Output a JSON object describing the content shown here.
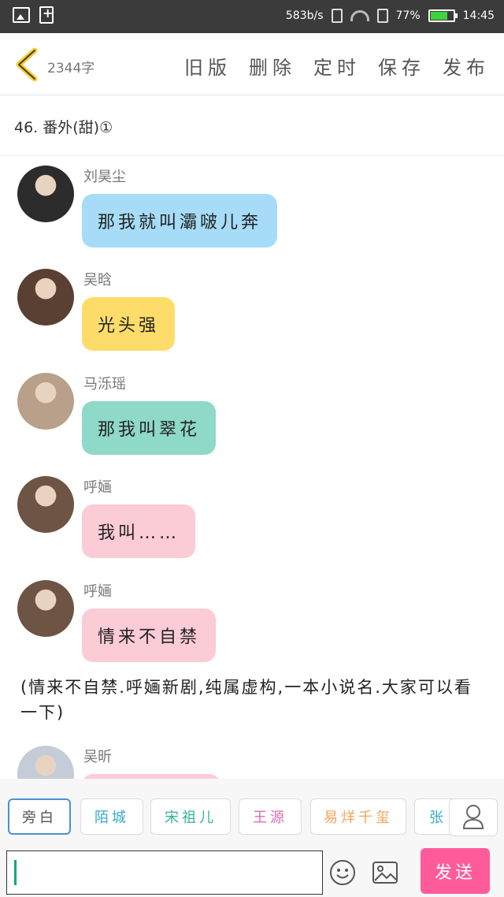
{
  "status_bar": {
    "speed": "583b/s",
    "battery": "77%",
    "time": "14:45",
    "battery_level": 0.77
  },
  "toolbar": {
    "word_count": "2344字",
    "actions": [
      "旧版",
      "删除",
      "定时",
      "保存",
      "发布"
    ]
  },
  "chapter_title": "46. 番外(甜)①",
  "messages": [
    {
      "name": "刘昊尘",
      "text": "那我就叫灞啵儿奔",
      "bubble_color": "#a6dcf7",
      "avatar_color": "#2c2c2c"
    },
    {
      "name": "吴晗",
      "text": "光头强",
      "bubble_color": "#fddc6a",
      "avatar_color": "#5a4032"
    },
    {
      "name": "马泺瑶",
      "text": "那我叫翠花",
      "bubble_color": "#8ed9c8",
      "avatar_color": "#b9a08a"
    },
    {
      "name": "呼婳",
      "text": "我叫……",
      "bubble_color": "#fbcbd6",
      "avatar_color": "#6e5444"
    },
    {
      "name": "呼婳",
      "text": "情来不自禁",
      "bubble_color": "#fbcbd6",
      "avatar_color": "#6e5444"
    },
    {
      "name": "吴昕",
      "text": "",
      "bubble_color": "#fbcbd6",
      "avatar_color": "#c4ccd8"
    }
  ],
  "narration": "(情来不自禁.呼婳新剧,纯属虚构,一本小说名.大家可以看一下)",
  "characters": [
    {
      "label": "旁白",
      "color": "#555555",
      "selected": true
    },
    {
      "label": "陌城",
      "color": "#38a9c8"
    },
    {
      "label": "宋祖儿",
      "color": "#3ab39a"
    },
    {
      "label": "王源",
      "color": "#e06bb4"
    },
    {
      "label": "易烊千玺",
      "color": "#f0a45c"
    },
    {
      "label": "张",
      "color": "#38a9c8"
    }
  ],
  "input": {
    "placeholder": ""
  },
  "send_label": "发送"
}
